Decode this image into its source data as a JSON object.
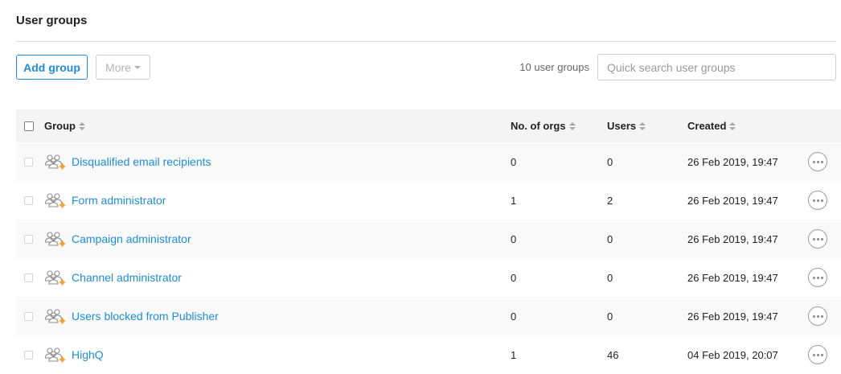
{
  "page": {
    "title": "User groups"
  },
  "toolbar": {
    "add_label": "Add group",
    "more_label": "More",
    "count_label": "10 user groups",
    "search_placeholder": "Quick search user groups"
  },
  "table": {
    "columns": {
      "group": "Group",
      "orgs": "No. of orgs",
      "users": "Users",
      "created": "Created"
    },
    "rows": [
      {
        "name": "Disqualified email recipients",
        "orgs": "0",
        "users": "0",
        "created": "26 Feb 2019, 19:47"
      },
      {
        "name": "Form administrator",
        "orgs": "1",
        "users": "2",
        "created": "26 Feb 2019, 19:47"
      },
      {
        "name": "Campaign administrator",
        "orgs": "0",
        "users": "0",
        "created": "26 Feb 2019, 19:47"
      },
      {
        "name": "Channel administrator",
        "orgs": "0",
        "users": "0",
        "created": "26 Feb 2019, 19:47"
      },
      {
        "name": "Users blocked from Publisher",
        "orgs": "0",
        "users": "0",
        "created": "26 Feb 2019, 19:47"
      },
      {
        "name": "HighQ",
        "orgs": "1",
        "users": "46",
        "created": "04 Feb 2019, 20:07"
      }
    ]
  },
  "colors": {
    "accent": "#1f8dd6",
    "gear": "#f0a030"
  },
  "icons": {
    "group": "user-group-gear-icon",
    "row_menu": "more-horizontal-icon"
  }
}
